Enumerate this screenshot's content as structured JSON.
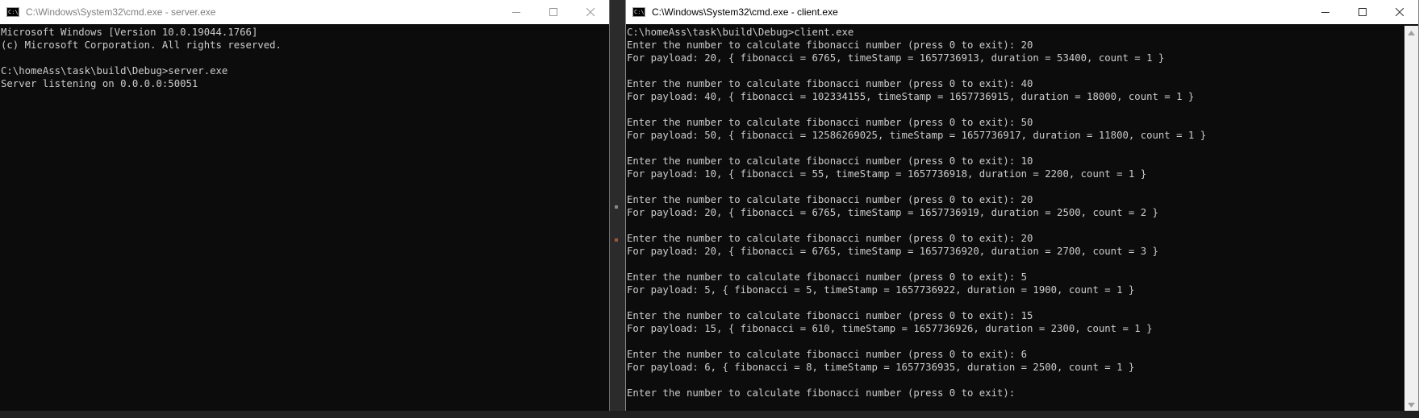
{
  "server_window": {
    "title": "C:\\Windows\\System32\\cmd.exe - server.exe",
    "lines": [
      "Microsoft Windows [Version 10.0.19044.1766]",
      "(c) Microsoft Corporation. All rights reserved.",
      "",
      "C:\\homeAss\\task\\build\\Debug>server.exe",
      "Server listening on 0.0.0.0:50051"
    ]
  },
  "client_window": {
    "title": "C:\\Windows\\System32\\cmd.exe - client.exe",
    "lines": [
      "C:\\homeAss\\task\\build\\Debug>client.exe",
      "Enter the number to calculate fibonacci number (press 0 to exit): 20",
      "For payload: 20, { fibonacci = 6765, timeStamp = 1657736913, duration = 53400, count = 1 }",
      "",
      "Enter the number to calculate fibonacci number (press 0 to exit): 40",
      "For payload: 40, { fibonacci = 102334155, timeStamp = 1657736915, duration = 18000, count = 1 }",
      "",
      "Enter the number to calculate fibonacci number (press 0 to exit): 50",
      "For payload: 50, { fibonacci = 12586269025, timeStamp = 1657736917, duration = 11800, count = 1 }",
      "",
      "Enter the number to calculate fibonacci number (press 0 to exit): 10",
      "For payload: 10, { fibonacci = 55, timeStamp = 1657736918, duration = 2200, count = 1 }",
      "",
      "Enter the number to calculate fibonacci number (press 0 to exit): 20",
      "For payload: 20, { fibonacci = 6765, timeStamp = 1657736919, duration = 2500, count = 2 }",
      "",
      "Enter the number to calculate fibonacci number (press 0 to exit): 20",
      "For payload: 20, { fibonacci = 6765, timeStamp = 1657736920, duration = 2700, count = 3 }",
      "",
      "Enter the number to calculate fibonacci number (press 0 to exit): 5",
      "For payload: 5, { fibonacci = 5, timeStamp = 1657736922, duration = 1900, count = 1 }",
      "",
      "Enter the number to calculate fibonacci number (press 0 to exit): 15",
      "For payload: 15, { fibonacci = 610, timeStamp = 1657736926, duration = 2300, count = 1 }",
      "",
      "Enter the number to calculate fibonacci number (press 0 to exit): 6",
      "For payload: 6, { fibonacci = 8, timeStamp = 1657736935, duration = 2500, count = 1 }",
      "",
      "Enter the number to calculate fibonacci number (press 0 to exit):"
    ]
  },
  "icons": {
    "window_icon": "cmd-window-icon",
    "minimize": "minimize-icon",
    "maximize": "maximize-icon",
    "close": "close-icon",
    "scroll_up": "scroll-up-arrow-icon",
    "scroll_down": "scroll-down-arrow-icon"
  },
  "colors": {
    "console_bg": "#0c0c0c",
    "console_fg": "#cccccc",
    "titlebar_bg": "#ffffff",
    "inactive_title_fg": "#808080"
  }
}
